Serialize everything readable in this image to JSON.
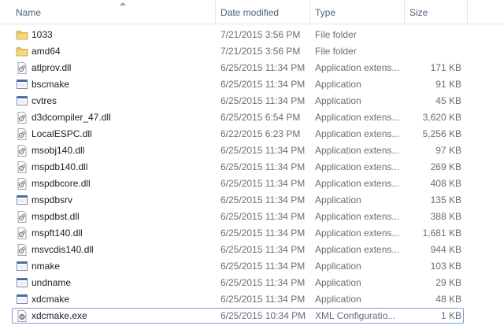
{
  "columns": {
    "name": "Name",
    "date": "Date modified",
    "type": "Type",
    "size": "Size"
  },
  "files": [
    {
      "name": "1033",
      "date": "7/21/2015 3:56 PM",
      "type": "File folder",
      "size": "",
      "icon": "folder-icon"
    },
    {
      "name": "amd64",
      "date": "7/21/2015 3:56 PM",
      "type": "File folder",
      "size": "",
      "icon": "folder-icon"
    },
    {
      "name": "atlprov.dll",
      "date": "6/25/2015 11:34 PM",
      "type": "Application extens...",
      "size": "171 KB",
      "icon": "dll-file-icon"
    },
    {
      "name": "bscmake",
      "date": "6/25/2015 11:34 PM",
      "type": "Application",
      "size": "91 KB",
      "icon": "application-icon"
    },
    {
      "name": "cvtres",
      "date": "6/25/2015 11:34 PM",
      "type": "Application",
      "size": "45 KB",
      "icon": "application-icon"
    },
    {
      "name": "d3dcompiler_47.dll",
      "date": "6/25/2015 6:54 PM",
      "type": "Application extens...",
      "size": "3,620 KB",
      "icon": "dll-file-icon"
    },
    {
      "name": "LocalESPC.dll",
      "date": "6/22/2015 6:23 PM",
      "type": "Application extens...",
      "size": "5,256 KB",
      "icon": "dll-file-icon"
    },
    {
      "name": "msobj140.dll",
      "date": "6/25/2015 11:34 PM",
      "type": "Application extens...",
      "size": "97 KB",
      "icon": "dll-file-icon"
    },
    {
      "name": "mspdb140.dll",
      "date": "6/25/2015 11:34 PM",
      "type": "Application extens...",
      "size": "269 KB",
      "icon": "dll-file-icon"
    },
    {
      "name": "mspdbcore.dll",
      "date": "6/25/2015 11:34 PM",
      "type": "Application extens...",
      "size": "408 KB",
      "icon": "dll-file-icon"
    },
    {
      "name": "mspdbsrv",
      "date": "6/25/2015 11:34 PM",
      "type": "Application",
      "size": "135 KB",
      "icon": "application-icon"
    },
    {
      "name": "mspdbst.dll",
      "date": "6/25/2015 11:34 PM",
      "type": "Application extens...",
      "size": "388 KB",
      "icon": "dll-file-icon"
    },
    {
      "name": "mspft140.dll",
      "date": "6/25/2015 11:34 PM",
      "type": "Application extens...",
      "size": "1,681 KB",
      "icon": "dll-file-icon"
    },
    {
      "name": "msvcdis140.dll",
      "date": "6/25/2015 11:34 PM",
      "type": "Application extens...",
      "size": "944 KB",
      "icon": "dll-file-icon"
    },
    {
      "name": "nmake",
      "date": "6/25/2015 11:34 PM",
      "type": "Application",
      "size": "103 KB",
      "icon": "application-icon"
    },
    {
      "name": "undname",
      "date": "6/25/2015 11:34 PM",
      "type": "Application",
      "size": "29 KB",
      "icon": "application-icon"
    },
    {
      "name": "xdcmake",
      "date": "6/25/2015 11:34 PM",
      "type": "Application",
      "size": "48 KB",
      "icon": "application-icon"
    },
    {
      "name": "xdcmake.exe",
      "date": "6/25/2015 10:34 PM",
      "type": "XML Configuratio...",
      "size": "1 KB",
      "icon": "config-file-icon",
      "selected": true
    }
  ],
  "colors": {
    "header_text": "#4c607a",
    "secondary_text": "#6d6d6d",
    "selection_border": "#7da2ce",
    "folder": "#e8c25a"
  }
}
